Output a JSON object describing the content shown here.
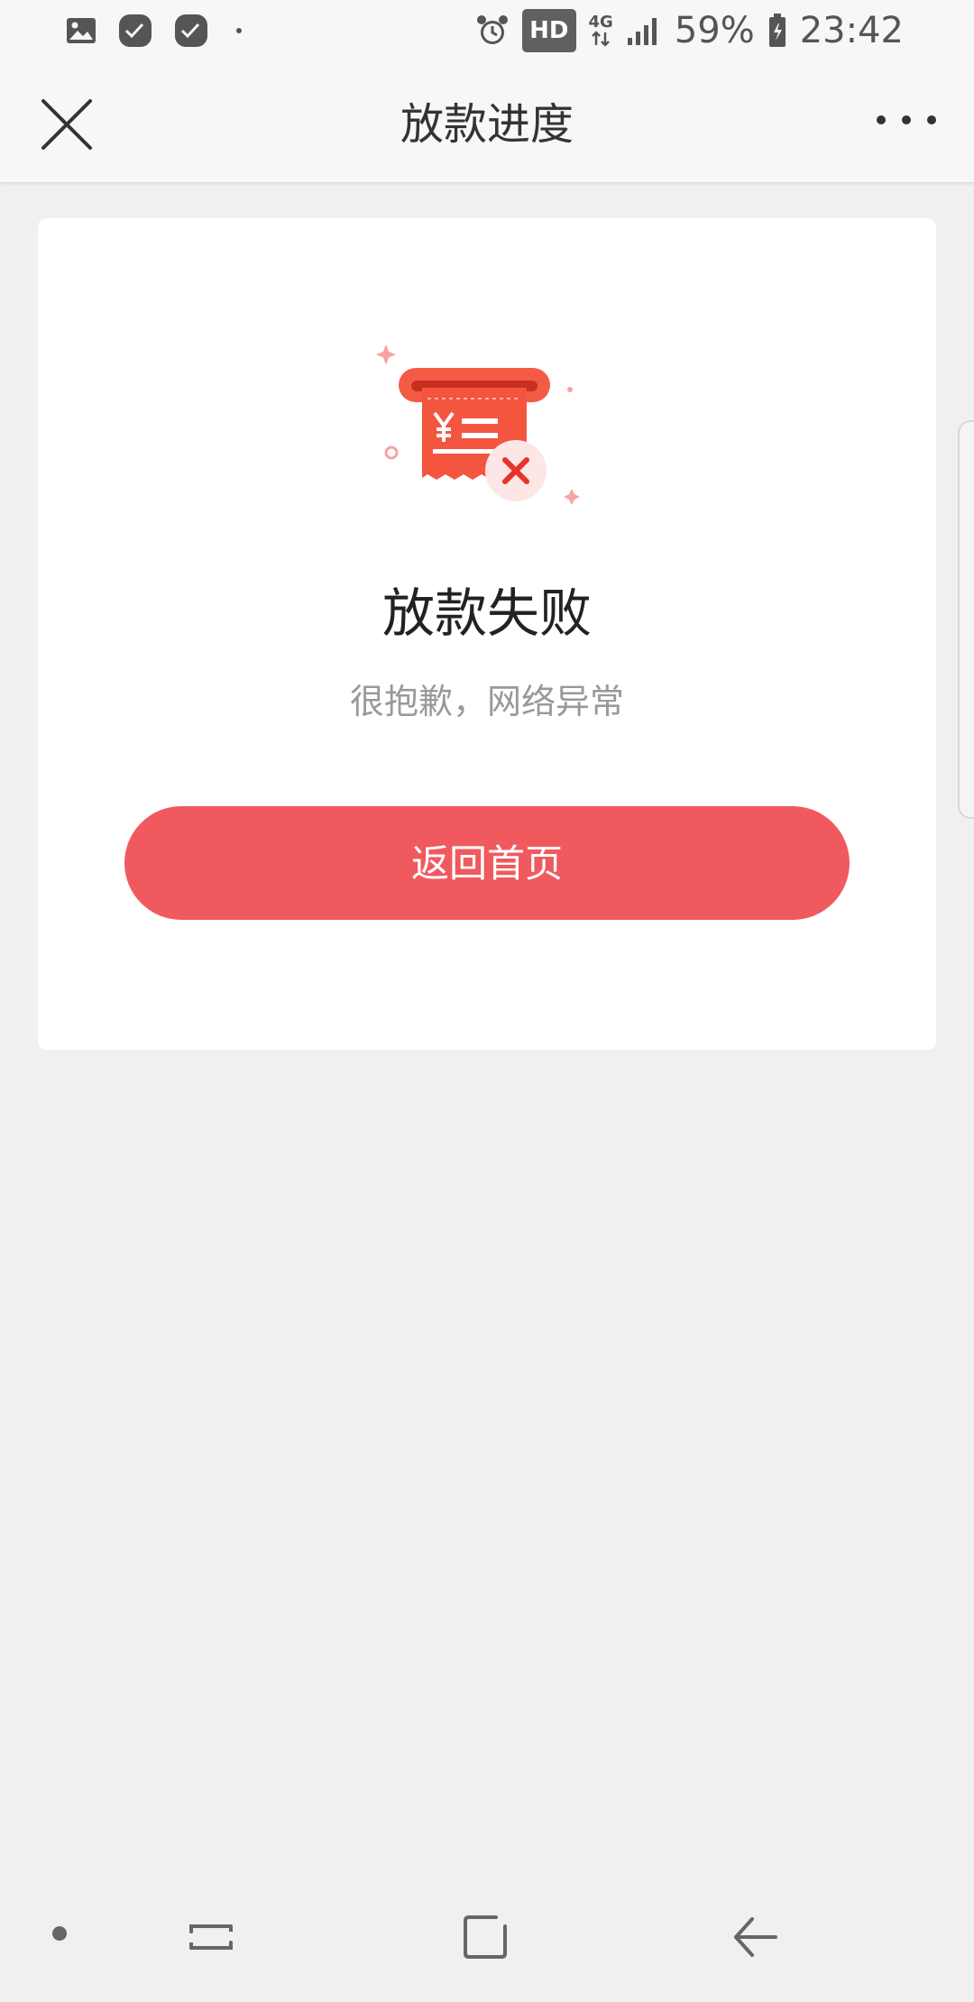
{
  "status_bar": {
    "network": "4G",
    "badge": "HD",
    "battery": "59%",
    "time": "23:42",
    "icons": [
      "gallery-icon",
      "app-notification-icon",
      "app-notification-icon",
      "alarm-icon",
      "signal-icon",
      "battery-icon"
    ]
  },
  "nav": {
    "title": "放款进度",
    "close_icon": "close-icon",
    "more_icon": "more-icon"
  },
  "result": {
    "title": "放款失败",
    "subtitle": "很抱歉，网络异常",
    "illustration": "receipt-failed-icon",
    "accent_color": "#f05a5e"
  },
  "actions": {
    "primary_label": "返回首页"
  },
  "system_nav": {
    "items": [
      "home-dot-icon",
      "recents-icon",
      "home-icon",
      "back-icon"
    ]
  }
}
